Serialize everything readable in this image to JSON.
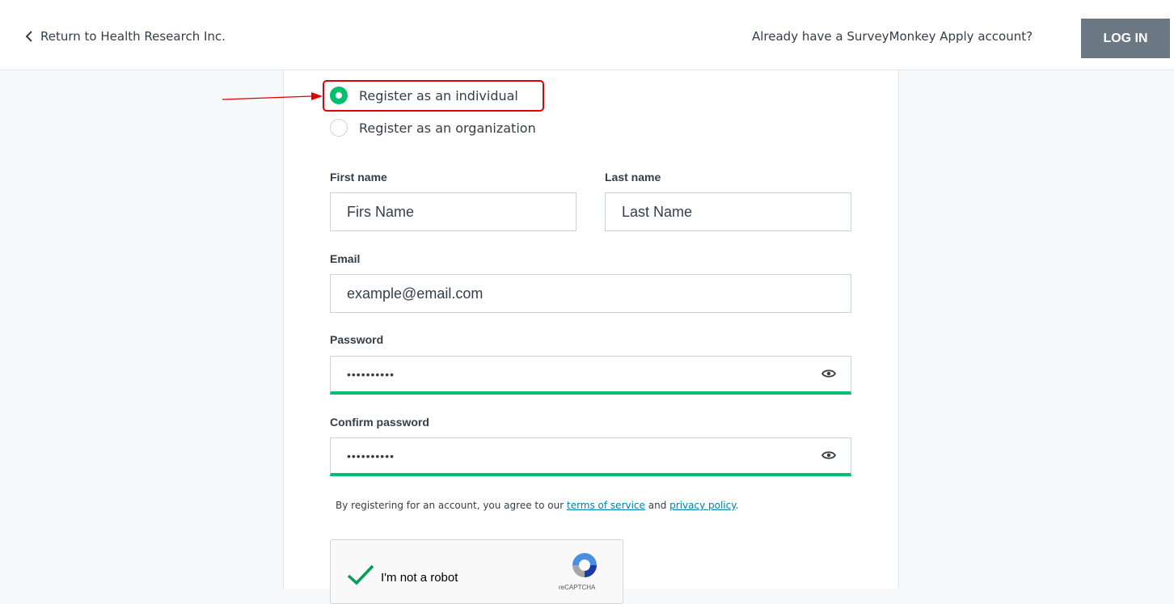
{
  "header": {
    "back_link": "Return to Health Research Inc.",
    "already_text": "Already have a SurveyMonkey Apply account?",
    "login_label": "LOG IN"
  },
  "register": {
    "individual_label": "Register as an individual",
    "organization_label": "Register as an organization",
    "selected": "individual"
  },
  "form": {
    "first_name_label": "First name",
    "first_name_placeholder": "Firs Name",
    "last_name_label": "Last name",
    "last_name_placeholder": "Last Name",
    "email_label": "Email",
    "email_placeholder": "example@email.com",
    "password_label": "Password",
    "password_value": "••••••••••",
    "confirm_label": "Confirm password",
    "confirm_value": "••••••••••"
  },
  "terms": {
    "prefix": "By registering for an account, you agree to our",
    "tos": "terms of service",
    "and": "and",
    "privacy": "privacy policy",
    "suffix": "."
  },
  "recaptcha": {
    "label": "I'm not a robot",
    "brand": "reCAPTCHA"
  },
  "colors": {
    "accent": "#00bf6f",
    "annotation": "#e00000",
    "link": "#007faa",
    "login_bg": "#6b7782"
  }
}
